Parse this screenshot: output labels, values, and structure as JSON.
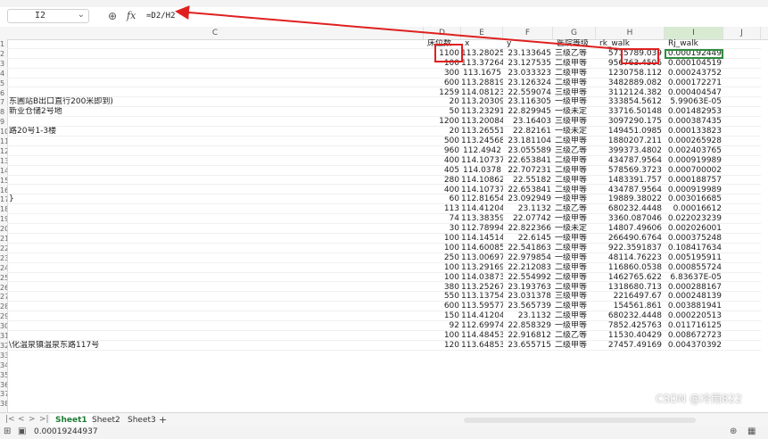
{
  "formula_bar": {
    "cell_ref": "I2",
    "formula": "=D2/H2",
    "zoom_icon": "zoom-icon",
    "fx_icon": "fx-icon"
  },
  "columns": [
    "C",
    "D",
    "E",
    "F",
    "G",
    "H",
    "I",
    "J"
  ],
  "active_column": "I",
  "header_row": {
    "D": "床位数",
    "E": "x",
    "F": "y",
    "G": "医院等级",
    "H": "rk_walk",
    "I": "Rj_walk"
  },
  "row_numbers": [
    "1",
    "2",
    "3",
    "4",
    "5",
    "6",
    "7",
    "8",
    "9",
    "10",
    "11",
    "12",
    "13",
    "14",
    "15",
    "16",
    "17",
    "18",
    "19",
    "20",
    "21",
    "22",
    "23",
    "24",
    "25",
    "26",
    "27",
    "28",
    "29",
    "30",
    "31",
    "32",
    "33",
    "34",
    "35",
    "36",
    "37",
    "38"
  ],
  "rows": [
    {
      "C": "",
      "D": "1100",
      "E": "113.28025",
      "F": "23.133645",
      "G": "三级乙等",
      "H": "5715789.039",
      "I": "0.000192449"
    },
    {
      "C": "",
      "D": "100",
      "E": "113.37264",
      "F": "23.127535",
      "G": "二级甲等",
      "H": "956763.4506",
      "I": "0.000104519"
    },
    {
      "C": "",
      "D": "300",
      "E": "113.1675",
      "F": "23.033323",
      "G": "二级甲等",
      "H": "1230758.112",
      "I": "0.000243752"
    },
    {
      "C": "",
      "D": "600",
      "E": "113.28819",
      "F": "23.126324",
      "G": "二级甲等",
      "H": "3482889.082",
      "I": "0.000172271"
    },
    {
      "C": "",
      "D": "1259",
      "E": "114.08123",
      "F": "22.559074",
      "G": "三级甲等",
      "H": "3112124.382",
      "I": "0.000404547"
    },
    {
      "C": "东圃站B出口直行200米即到)",
      "D": "20",
      "E": "113.20309",
      "F": "23.116305",
      "G": "一级甲等",
      "H": "333854.5612",
      "I": "5.99063E-05"
    },
    {
      "C": "新业仓储2号地",
      "D": "50",
      "E": "113.23291",
      "F": "22.829945",
      "G": "一级未定",
      "H": "33716.50148",
      "I": "0.001482953"
    },
    {
      "C": "",
      "D": "1200",
      "E": "113.20084",
      "F": "23.16403",
      "G": "三级甲等",
      "H": "3097290.175",
      "I": "0.000387435"
    },
    {
      "C": "路20号1-3楼",
      "D": "20",
      "E": "113.26551",
      "F": "22.82161",
      "G": "一级未定",
      "H": "149451.0985",
      "I": "0.000133823"
    },
    {
      "C": "",
      "D": "500",
      "E": "113.24568",
      "F": "23.181104",
      "G": "二级甲等",
      "H": "1880207.211",
      "I": "0.000265928"
    },
    {
      "C": "",
      "D": "960",
      "E": "112.4942",
      "F": "23.055589",
      "G": "三级乙等",
      "H": "399373.4802",
      "I": "0.002403765"
    },
    {
      "C": "",
      "D": "400",
      "E": "114.10737",
      "F": "22.653841",
      "G": "二级甲等",
      "H": "434787.9564",
      "I": "0.000919989"
    },
    {
      "C": "",
      "D": "405",
      "E": "114.0378",
      "F": "22.707231",
      "G": "二级甲等",
      "H": "578569.3723",
      "I": "0.000700002"
    },
    {
      "C": "",
      "D": "280",
      "E": "114.10862",
      "F": "22.55182",
      "G": "二级甲等",
      "H": "1483391.757",
      "I": "0.000188757"
    },
    {
      "C": "",
      "D": "400",
      "E": "114.10737",
      "F": "22.653841",
      "G": "二级甲等",
      "H": "434787.9564",
      "I": "0.000919989"
    },
    {
      "C": "}",
      "D": "60",
      "E": "112.81654",
      "F": "23.092949",
      "G": "一级甲等",
      "H": "19889.38022",
      "I": "0.003016685"
    },
    {
      "C": "",
      "D": "113",
      "E": "114.41204",
      "F": "23.1132",
      "G": "二级乙等",
      "H": "680232.4448",
      "I": "0.00016612"
    },
    {
      "C": "",
      "D": "74",
      "E": "113.38359",
      "F": "22.07742",
      "G": "一级甲等",
      "H": "3360.087046",
      "I": "0.022023239"
    },
    {
      "C": "",
      "D": "30",
      "E": "112.78994",
      "F": "22.822366",
      "G": "一级未定",
      "H": "14807.49606",
      "I": "0.002026001"
    },
    {
      "C": "",
      "D": "100",
      "E": "114.14514",
      "F": "22.6145",
      "G": "一级甲等",
      "H": "266490.6764",
      "I": "0.000375248"
    },
    {
      "C": "",
      "D": "100",
      "E": "114.60085",
      "F": "22.541863",
      "G": "二级甲等",
      "H": "922.3591837",
      "I": "0.108417634"
    },
    {
      "C": "",
      "D": "250",
      "E": "113.00697",
      "F": "22.979854",
      "G": "一级甲等",
      "H": "48114.76223",
      "I": "0.005195911"
    },
    {
      "C": "",
      "D": "100",
      "E": "113.29169",
      "F": "22.212083",
      "G": "二级甲等",
      "H": "116860.0538",
      "I": "0.000855724"
    },
    {
      "C": "",
      "D": "100",
      "E": "114.03873",
      "F": "22.554992",
      "G": "二级甲等",
      "H": "1462765.622",
      "I": "6.83637E-05"
    },
    {
      "C": "",
      "D": "380",
      "E": "113.25267",
      "F": "23.193763",
      "G": "二级甲等",
      "H": "1318680.713",
      "I": "0.000288167"
    },
    {
      "C": "",
      "D": "550",
      "E": "113.13754",
      "F": "23.031378",
      "G": "三级甲等",
      "H": "2216497.67",
      "I": "0.000248139"
    },
    {
      "C": "",
      "D": "600",
      "E": "113.59577",
      "F": "23.565739",
      "G": "二级甲等",
      "H": "154561.861",
      "I": "0.003881941"
    },
    {
      "C": "",
      "D": "150",
      "E": "114.41204",
      "F": "23.1132",
      "G": "二级甲等",
      "H": "680232.4448",
      "I": "0.000220513"
    },
    {
      "C": "",
      "D": "92",
      "E": "112.69974",
      "F": "22.858329",
      "G": "一级甲等",
      "H": "7852.425763",
      "I": "0.011716125"
    },
    {
      "C": "",
      "D": "100",
      "E": "114.48453",
      "F": "22.916812",
      "G": "二级乙等",
      "H": "11530.40429",
      "I": "0.008672723"
    },
    {
      "C": "\\化温泉镇温泉东路117号",
      "D": "120",
      "E": "113.64853",
      "F": "23.655715",
      "G": "二级甲等",
      "H": "27457.49169",
      "I": "0.004370392"
    }
  ],
  "sheet_tabs": [
    {
      "label": "Sheet1",
      "active": true
    },
    {
      "label": "Sheet2",
      "active": false
    },
    {
      "label": "Sheet3",
      "active": false
    }
  ],
  "add_tab_label": "+",
  "status": {
    "value": "0.00019244937"
  },
  "watermark": "CSDN @冷雨822"
}
